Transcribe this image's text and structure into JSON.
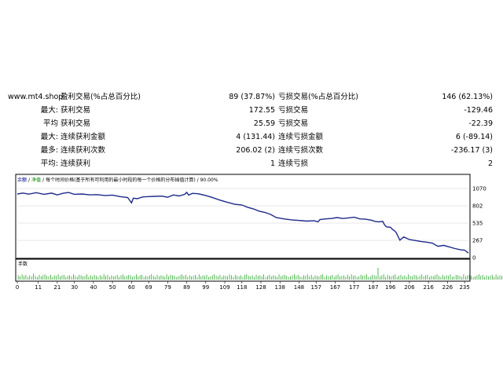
{
  "stats": {
    "site": "www.mt4.shop",
    "rows": [
      {
        "label": "",
        "name1": "盈利交易(%占总百分比)",
        "value1": "89 (37.87%)",
        "name2": "亏损交易(%占总百分比)",
        "value2": "146 (62.13%)"
      },
      {
        "label": "最大:",
        "name1": "获利交易",
        "value1": "172.55",
        "name2": "亏损交易",
        "value2": "-129.46"
      },
      {
        "label": "平均",
        "name1": "获利交易",
        "value1": "25.59",
        "name2": "亏损交易",
        "value2": "-22.39"
      },
      {
        "label": "最大:",
        "name1": "连续获利金额",
        "value1": "4 (131.44)",
        "name2": "连续亏损金额",
        "value2": "6 (-89.14)"
      },
      {
        "label": "最多:",
        "name1": "连续获利次数",
        "value1": "206.02 (2)",
        "name2": "连续亏损次数",
        "value2": "-236.17 (3)"
      },
      {
        "label": "平均:",
        "name1": "连续获利",
        "value1": "1",
        "name2": "连续亏损",
        "value2": "2"
      }
    ]
  },
  "chart_header": {
    "balance": "余额",
    "equity": "净值",
    "description": "每个时间价格(基于所有可利用的最小时段的每一个价格的分布插值计算) / 90.00%"
  },
  "volume_label": "手数",
  "colors": {
    "balance": "#1e2a8a",
    "volume": "#2aa52a",
    "frame": "#000000",
    "grid": "#d0d0d0"
  },
  "chart_data": {
    "type": "line",
    "y_ticks": [
      0,
      267,
      535,
      802,
      1070
    ],
    "x_ticks": [
      0,
      11,
      21,
      30,
      40,
      50,
      60,
      69,
      79,
      89,
      99,
      109,
      118,
      128,
      138,
      148,
      157,
      167,
      177,
      187,
      196,
      206,
      216,
      226,
      235
    ],
    "xlim": [
      0,
      237
    ],
    "ylim": [
      0,
      1070
    ],
    "balance": [
      [
        0,
        985
      ],
      [
        3,
        1000
      ],
      [
        6,
        982
      ],
      [
        10,
        1005
      ],
      [
        14,
        980
      ],
      [
        18,
        998
      ],
      [
        21,
        970
      ],
      [
        24,
        996
      ],
      [
        27,
        1008
      ],
      [
        30,
        980
      ],
      [
        34,
        985
      ],
      [
        38,
        972
      ],
      [
        42,
        975
      ],
      [
        46,
        962
      ],
      [
        50,
        968
      ],
      [
        54,
        945
      ],
      [
        58,
        930
      ],
      [
        60,
        848
      ],
      [
        61,
        920
      ],
      [
        63,
        912
      ],
      [
        66,
        940
      ],
      [
        69,
        945
      ],
      [
        72,
        948
      ],
      [
        76,
        952
      ],
      [
        79,
        935
      ],
      [
        82,
        970
      ],
      [
        85,
        955
      ],
      [
        88,
        980
      ],
      [
        89,
        1010
      ],
      [
        90,
        968
      ],
      [
        92,
        995
      ],
      [
        95,
        988
      ],
      [
        99,
        962
      ],
      [
        102,
        935
      ],
      [
        106,
        895
      ],
      [
        110,
        860
      ],
      [
        114,
        828
      ],
      [
        118,
        815
      ],
      [
        121,
        780
      ],
      [
        124,
        755
      ],
      [
        127,
        720
      ],
      [
        130,
        700
      ],
      [
        133,
        670
      ],
      [
        136,
        620
      ],
      [
        140,
        600
      ],
      [
        144,
        585
      ],
      [
        148,
        575
      ],
      [
        152,
        565
      ],
      [
        156,
        570
      ],
      [
        158,
        555
      ],
      [
        159,
        590
      ],
      [
        162,
        600
      ],
      [
        165,
        605
      ],
      [
        168,
        620
      ],
      [
        171,
        605
      ],
      [
        174,
        615
      ],
      [
        177,
        625
      ],
      [
        180,
        600
      ],
      [
        183,
        595
      ],
      [
        186,
        580
      ],
      [
        188,
        560
      ],
      [
        190,
        555
      ],
      [
        192,
        560
      ],
      [
        193,
        505
      ],
      [
        194,
        475
      ],
      [
        196,
        470
      ],
      [
        197,
        440
      ],
      [
        198,
        420
      ],
      [
        199,
        390
      ],
      [
        201,
        270
      ],
      [
        203,
        320
      ],
      [
        206,
        280
      ],
      [
        209,
        265
      ],
      [
        212,
        250
      ],
      [
        215,
        240
      ],
      [
        218,
        225
      ],
      [
        221,
        175
      ],
      [
        224,
        190
      ],
      [
        227,
        165
      ],
      [
        230,
        140
      ],
      [
        233,
        120
      ],
      [
        235,
        115
      ],
      [
        237,
        70
      ]
    ],
    "volume": [
      8,
      6,
      10,
      7,
      9,
      5,
      8,
      6,
      11,
      7,
      5,
      9,
      6,
      8,
      10,
      7,
      6,
      9,
      5,
      8,
      7,
      10,
      6,
      8,
      9,
      5,
      7,
      8,
      6,
      10,
      7,
      5,
      9,
      8,
      6,
      7,
      10,
      5,
      8,
      6,
      9,
      7,
      5,
      8,
      6,
      10,
      7,
      9,
      5,
      8,
      6,
      7,
      9,
      5,
      8,
      10,
      6,
      7,
      9,
      8,
      5,
      7,
      10,
      6,
      8,
      9,
      5,
      7,
      6,
      8,
      10,
      7,
      5,
      9,
      6,
      8,
      7,
      5,
      10,
      6,
      9,
      8,
      7,
      5,
      6,
      8,
      10,
      7,
      9,
      5,
      8,
      6,
      7,
      9,
      5,
      10,
      6,
      8,
      7,
      9,
      5,
      6,
      8,
      10,
      7,
      6,
      9,
      5,
      8,
      7,
      6,
      10,
      8,
      5,
      9,
      7,
      6,
      8,
      5,
      9,
      10,
      7,
      6,
      8,
      5,
      9,
      7,
      8,
      6,
      10,
      5,
      7,
      9,
      6,
      8,
      7,
      5,
      10,
      6,
      8,
      9,
      7,
      5,
      6,
      8,
      10,
      7,
      9,
      6,
      5,
      8,
      7,
      10,
      6,
      9,
      5,
      8,
      7,
      6,
      9,
      10,
      5,
      8,
      6,
      7,
      9,
      5,
      8,
      10,
      6,
      7,
      8,
      5,
      9,
      6,
      10,
      7,
      8,
      5,
      6,
      9,
      7,
      8,
      10,
      5,
      6,
      9,
      8,
      7,
      22,
      6,
      8,
      10,
      5,
      9,
      7,
      6,
      8,
      10,
      5,
      7,
      9,
      6,
      8,
      5,
      10,
      7,
      6,
      9,
      8,
      5,
      7,
      10,
      6,
      8,
      9,
      5,
      7,
      6,
      8,
      10,
      7,
      5,
      9,
      6,
      8,
      7,
      10,
      5,
      6,
      9,
      8,
      7,
      5,
      10,
      6,
      8,
      9,
      7,
      5,
      6,
      8,
      10,
      7,
      9,
      5,
      8,
      6,
      7,
      9,
      5,
      10,
      6,
      8,
      7,
      9
    ]
  }
}
